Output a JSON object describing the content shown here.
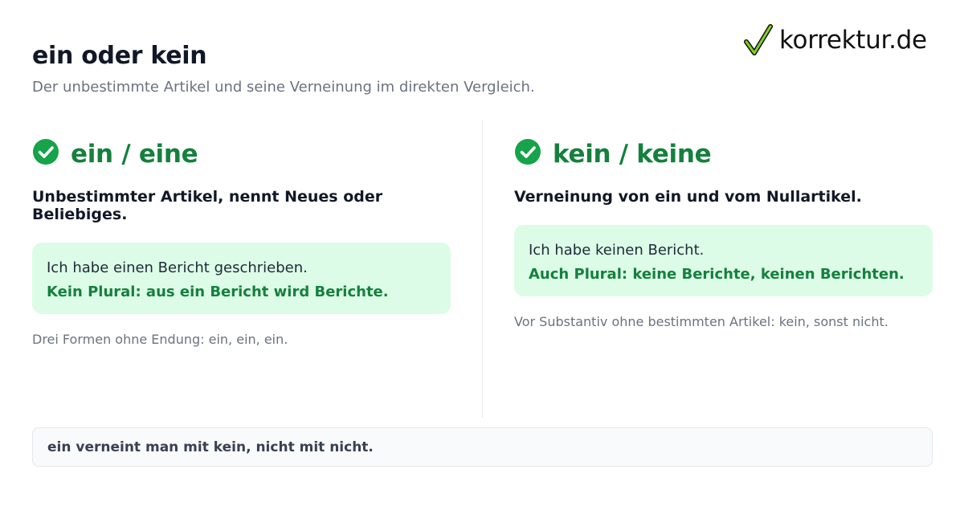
{
  "header": {
    "title": "ein oder kein",
    "subtitle": "Der unbestimmte Artikel und seine Verneinung im direkten Vergleich."
  },
  "brand": {
    "logo_text": "korrektur.de",
    "logo_icon": "checkmark-icon",
    "accent_color": "#15803d",
    "check_color": "#16a34a",
    "example_bg": "#dcfce7"
  },
  "columns": [
    {
      "icon": "check-circle-icon",
      "title": "ein / eine",
      "description": "Unbestimmter Artikel, nennt Neues oder Beliebiges.",
      "example": "Ich habe einen Bericht geschrieben.",
      "note": "Kein Plural: aus ein Bericht wird Berichte.",
      "hint": "Drei Formen ohne Endung: ein, ein, ein."
    },
    {
      "icon": "check-circle-icon",
      "title": "kein / keine",
      "description": "Verneinung von ein und vom Nullartikel.",
      "example": "Ich habe keinen Bericht.",
      "note": "Auch Plural: keine Berichte, keinen Berichten.",
      "hint": "Vor Substantiv ohne bestimmten Artikel: kein, sonst nicht."
    }
  ],
  "footer": {
    "text": "ein verneint man mit kein, nicht mit nicht."
  }
}
